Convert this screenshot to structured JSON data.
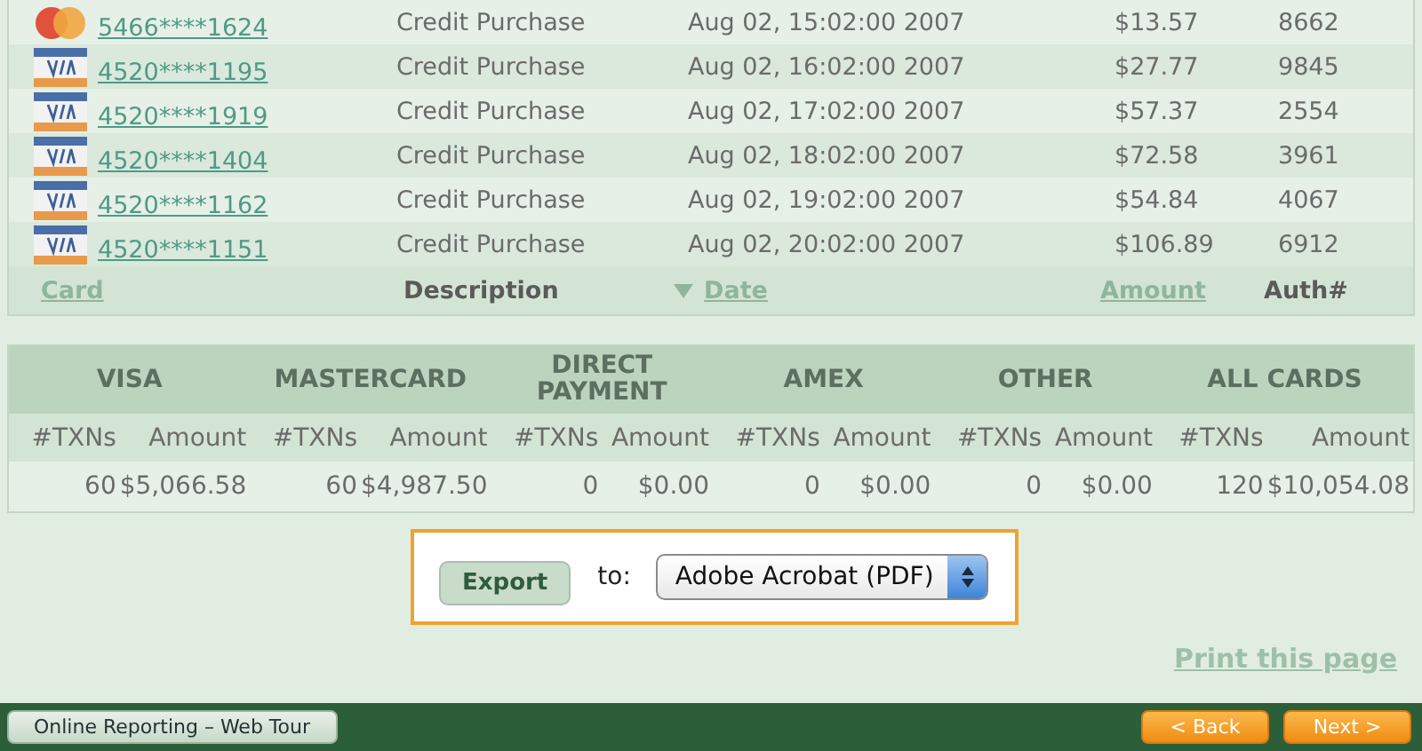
{
  "transactions": {
    "rows": [
      {
        "kind": "mastercard",
        "card": "5466****1624",
        "description": "Credit Purchase",
        "date": "Aug 02, 15:02:00 2007",
        "amount": "$13.57",
        "auth": "8662"
      },
      {
        "kind": "visa",
        "card": "4520****1195",
        "description": "Credit Purchase",
        "date": "Aug 02, 16:02:00 2007",
        "amount": "$27.77",
        "auth": "9845"
      },
      {
        "kind": "visa",
        "card": "4520****1919",
        "description": "Credit Purchase",
        "date": "Aug 02, 17:02:00 2007",
        "amount": "$57.37",
        "auth": "2554"
      },
      {
        "kind": "visa",
        "card": "4520****1404",
        "description": "Credit Purchase",
        "date": "Aug 02, 18:02:00 2007",
        "amount": "$72.58",
        "auth": "3961"
      },
      {
        "kind": "visa",
        "card": "4520****1162",
        "description": "Credit Purchase",
        "date": "Aug 02, 19:02:00 2007",
        "amount": "$54.84",
        "auth": "4067"
      },
      {
        "kind": "visa",
        "card": "4520****1151",
        "description": "Credit Purchase",
        "date": "Aug 02, 20:02:00 2007",
        "amount": "$106.89",
        "auth": "6912"
      }
    ],
    "columns": [
      {
        "label": "Card",
        "sortable": true,
        "sorted": false
      },
      {
        "label": "Description",
        "sortable": false,
        "sorted": false
      },
      {
        "label": "Date",
        "sortable": true,
        "sorted": true
      },
      {
        "label": "Amount",
        "sortable": true,
        "sorted": false
      },
      {
        "label": "Auth#",
        "sortable": false,
        "sorted": false
      }
    ]
  },
  "summary": {
    "groups": [
      {
        "label": "VISA",
        "txns_header": "#TXNs",
        "amount_header": "Amount",
        "txns": "60",
        "amount": "$5,066.58"
      },
      {
        "label": "MASTERCARD",
        "txns_header": "#TXNs",
        "amount_header": "Amount",
        "txns": "60",
        "amount": "$4,987.50"
      },
      {
        "label": "DIRECT PAYMENT",
        "txns_header": "#TXNs",
        "amount_header": "Amount",
        "txns": "0",
        "amount": "$0.00"
      },
      {
        "label": "AMEX",
        "txns_header": "#TXNs",
        "amount_header": "Amount",
        "txns": "0",
        "amount": "$0.00"
      },
      {
        "label": "OTHER",
        "txns_header": "#TXNs",
        "amount_header": "Amount",
        "txns": "0",
        "amount": "$0.00"
      },
      {
        "label": "ALL CARDS",
        "txns_header": "#TXNs",
        "amount_header": "Amount",
        "txns": "120",
        "amount": "$10,054.08"
      }
    ]
  },
  "export": {
    "button": "Export",
    "to_label": "to:",
    "format": "Adobe Acrobat (PDF)"
  },
  "print_link": "Print this page",
  "footer": {
    "title_button": "Online Reporting – Web Tour",
    "back": "< Back",
    "next": "Next >"
  }
}
